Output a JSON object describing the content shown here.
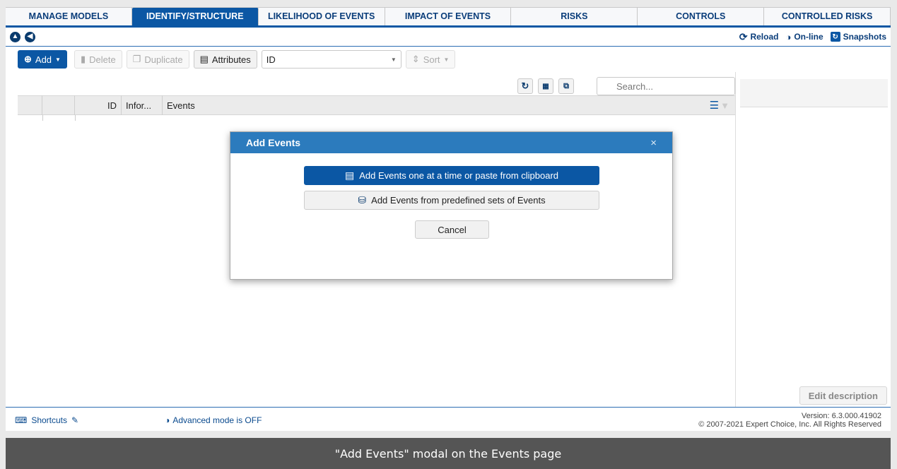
{
  "tabs": [
    "MANAGE MODELS",
    "IDENTIFY/STRUCTURE",
    "LIKELIHOOD OF EVENTS",
    "IMPACT OF EVENTS",
    "RISKS",
    "CONTROLS",
    "CONTROLLED RISKS"
  ],
  "active_tab": "IDENTIFY/STRUCTURE",
  "navbar": {
    "up_icon": "arrow-up-circle-icon",
    "back_icon": "arrow-left-circle-icon",
    "reload_label": "Reload",
    "online_label": "On-line",
    "snapshots_label": "Snapshots"
  },
  "toolbar": {
    "add_label": "Add",
    "delete_label": "Delete",
    "duplicate_label": "Duplicate",
    "attributes_label": "Attributes",
    "id_select_value": "ID",
    "sort_label": "Sort"
  },
  "grid": {
    "search_placeholder": "Search...",
    "columns": [
      "ID",
      "Infor...",
      "Events"
    ]
  },
  "modal": {
    "title": "Add Events",
    "close_symbol": "×",
    "option_one_label": "Add Events one at a time or paste from clipboard",
    "option_two_label": "Add Events from predefined sets of Events",
    "cancel_label": "Cancel"
  },
  "right_pane": {
    "edit_description_label": "Edit description"
  },
  "footer": {
    "shortcuts_label": "Shortcuts",
    "advanced_mode_label": "Advanced mode is OFF",
    "version_text": "Version: 6.3.000.41902",
    "copyright_text": "© 2007-2021 Expert Choice, Inc. All Rights Reserved"
  },
  "caption": "\"Add Events\" modal on the Events page",
  "colors": {
    "primary": "#0b57a4",
    "modal_header": "#2c7bbd",
    "caption_bg": "#555555"
  }
}
